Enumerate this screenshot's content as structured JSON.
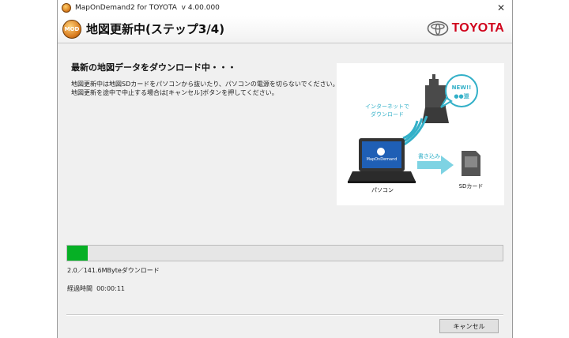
{
  "window": {
    "title": "MapOnDemand2 for TOYOTA  v 4.00.000"
  },
  "header": {
    "title": "地図更新中(ステップ3/4)",
    "brand": "TOYOTA"
  },
  "main": {
    "heading": "最新の地図データをダウンロード中・・・",
    "desc_line1": "地図更新中は地図SDカードをパソコンから抜いたり、パソコンの電源を切らないでください。",
    "desc_line2": "地図更新を途中で中止する場合は[キャンセル]ボタンを押してください。"
  },
  "illustration": {
    "badge_line1": "NEW!!",
    "badge_line2": "●●道",
    "download_line1": "インターネットで",
    "download_line2": "ダウンロード",
    "write_label": "書き込み",
    "pc_label": "パソコン",
    "sd_label": "SDカード",
    "screen_text": "MapOnDemand"
  },
  "progress": {
    "fraction": 0.0141,
    "size_text": "2.0／141.6MByteダウンロード",
    "elapsed_text": "経過時間  00:00:11"
  },
  "footer": {
    "cancel_label": "キャンセル"
  },
  "colors": {
    "progress": "#06b025",
    "brand": "#d0021b",
    "accent": "#33b0c8"
  }
}
